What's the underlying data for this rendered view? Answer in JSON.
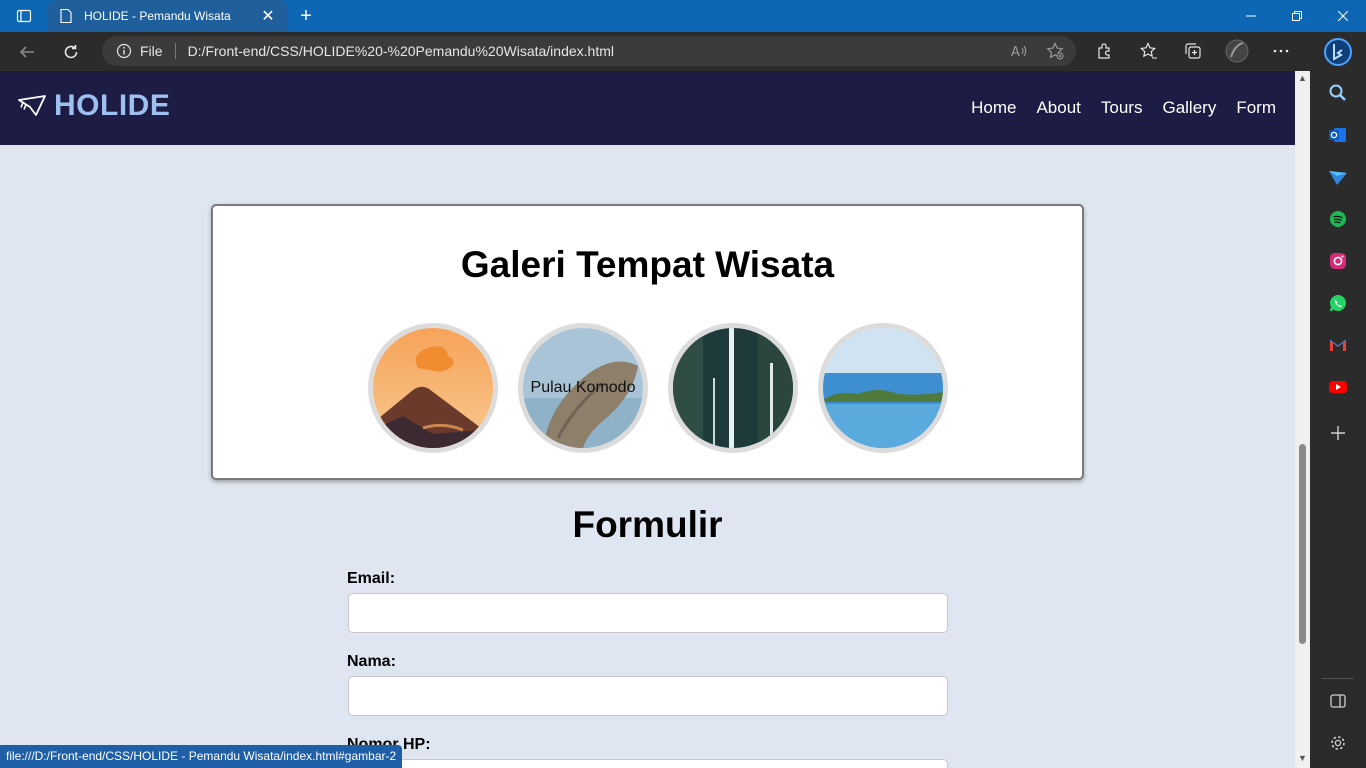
{
  "browser": {
    "tab_title": "HOLIDE - Pemandu Wisata",
    "new_tab_symbol": "+",
    "url_label": "File",
    "url": "D:/Front-end/CSS/HOLIDE%20-%20Pemandu%20Wisata/index.html",
    "status_url": "file:///D:/Front-end/CSS/HOLIDE - Pemandu Wisata/index.html#gambar-2",
    "accent": "#0e67b4"
  },
  "site": {
    "logo": "HOLIDE",
    "logo_color": "#9dc0f0",
    "header_bg": "#1d1c44",
    "nav": [
      "Home",
      "About",
      "Tours",
      "Gallery",
      "Form"
    ]
  },
  "gallery": {
    "title": "Galeri Tempat Wisata",
    "items": [
      {
        "caption": "",
        "icon": "volcano-photo"
      },
      {
        "caption": "Pulau Komodo",
        "icon": "komodo-island-photo"
      },
      {
        "caption": "",
        "icon": "waterfall-photo"
      },
      {
        "caption": "",
        "icon": "beach-island-photo"
      }
    ]
  },
  "form": {
    "title": "Formulir",
    "fields": [
      {
        "label": "Email:"
      },
      {
        "label": "Nama:"
      },
      {
        "label": "Nomor HP:"
      }
    ]
  }
}
